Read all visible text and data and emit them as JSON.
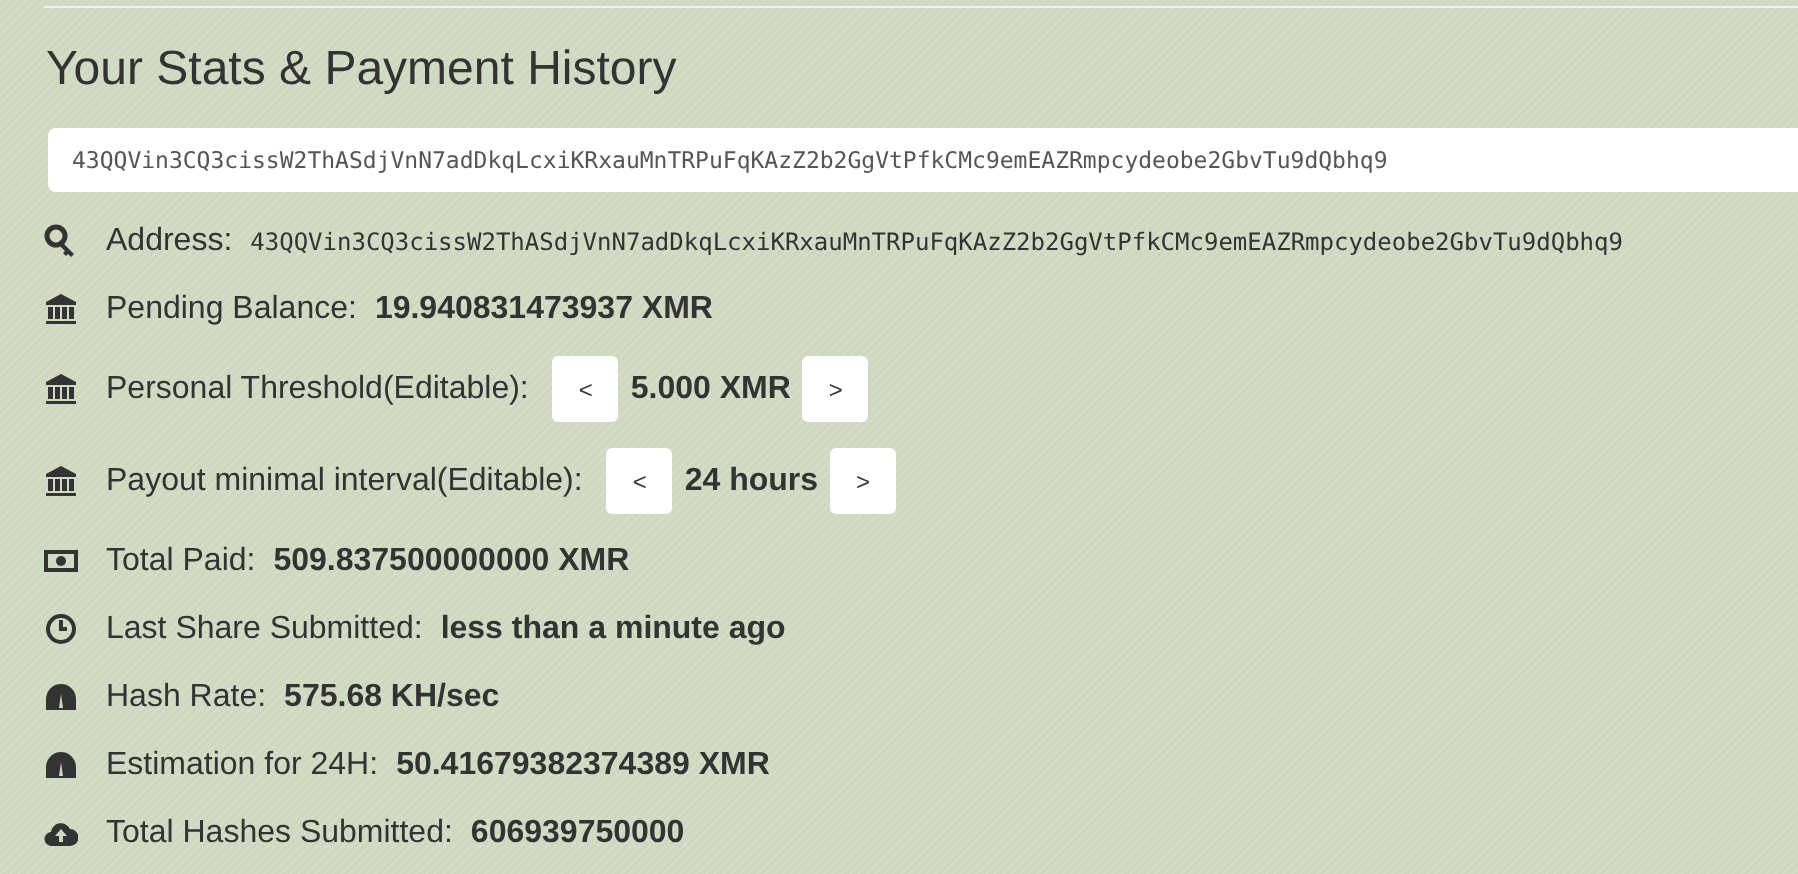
{
  "heading": "Your Stats & Payment History",
  "address_field": {
    "value": "43QQVin3CQ3cissW2ThASdjVnN7adDkqLcxiKRxauMnTRPuFqKAzZ2b2GgVtPfkCMc9emEAZRmpcydeobe2GbvTu9dQbhq9"
  },
  "stats": [
    {
      "kind": "mono",
      "label": "Address:",
      "value": "43QQVin3CQ3cissW2ThASdjVnN7adDkqLcxiKRxauMnTRPuFqKAzZ2b2GgVtPfkCMc9emEAZRmpcydeobe2GbvTu9dQbhq9"
    },
    {
      "kind": "bold",
      "label": "Pending Balance:",
      "value": "19.940831473937 XMR"
    },
    {
      "kind": "stepper",
      "label": "Personal Threshold(Editable):",
      "value": "5.000 XMR",
      "decrease": "<",
      "increase": ">"
    },
    {
      "kind": "stepper",
      "label": "Payout minimal interval(Editable):",
      "value": "24 hours",
      "decrease": "<",
      "increase": ">"
    },
    {
      "kind": "bold",
      "label": "Total Paid:",
      "value": "509.837500000000 XMR"
    },
    {
      "kind": "bold",
      "label": "Last Share Submitted:",
      "value": "less than a minute ago"
    },
    {
      "kind": "bold",
      "label": "Hash Rate:",
      "value": "575.68 KH/sec"
    },
    {
      "kind": "bold",
      "label": "Estimation for 24H:",
      "value": "50.41679382374389 XMR"
    },
    {
      "kind": "bold",
      "label": "Total Hashes Submitted:",
      "value": "606939750000"
    }
  ]
}
